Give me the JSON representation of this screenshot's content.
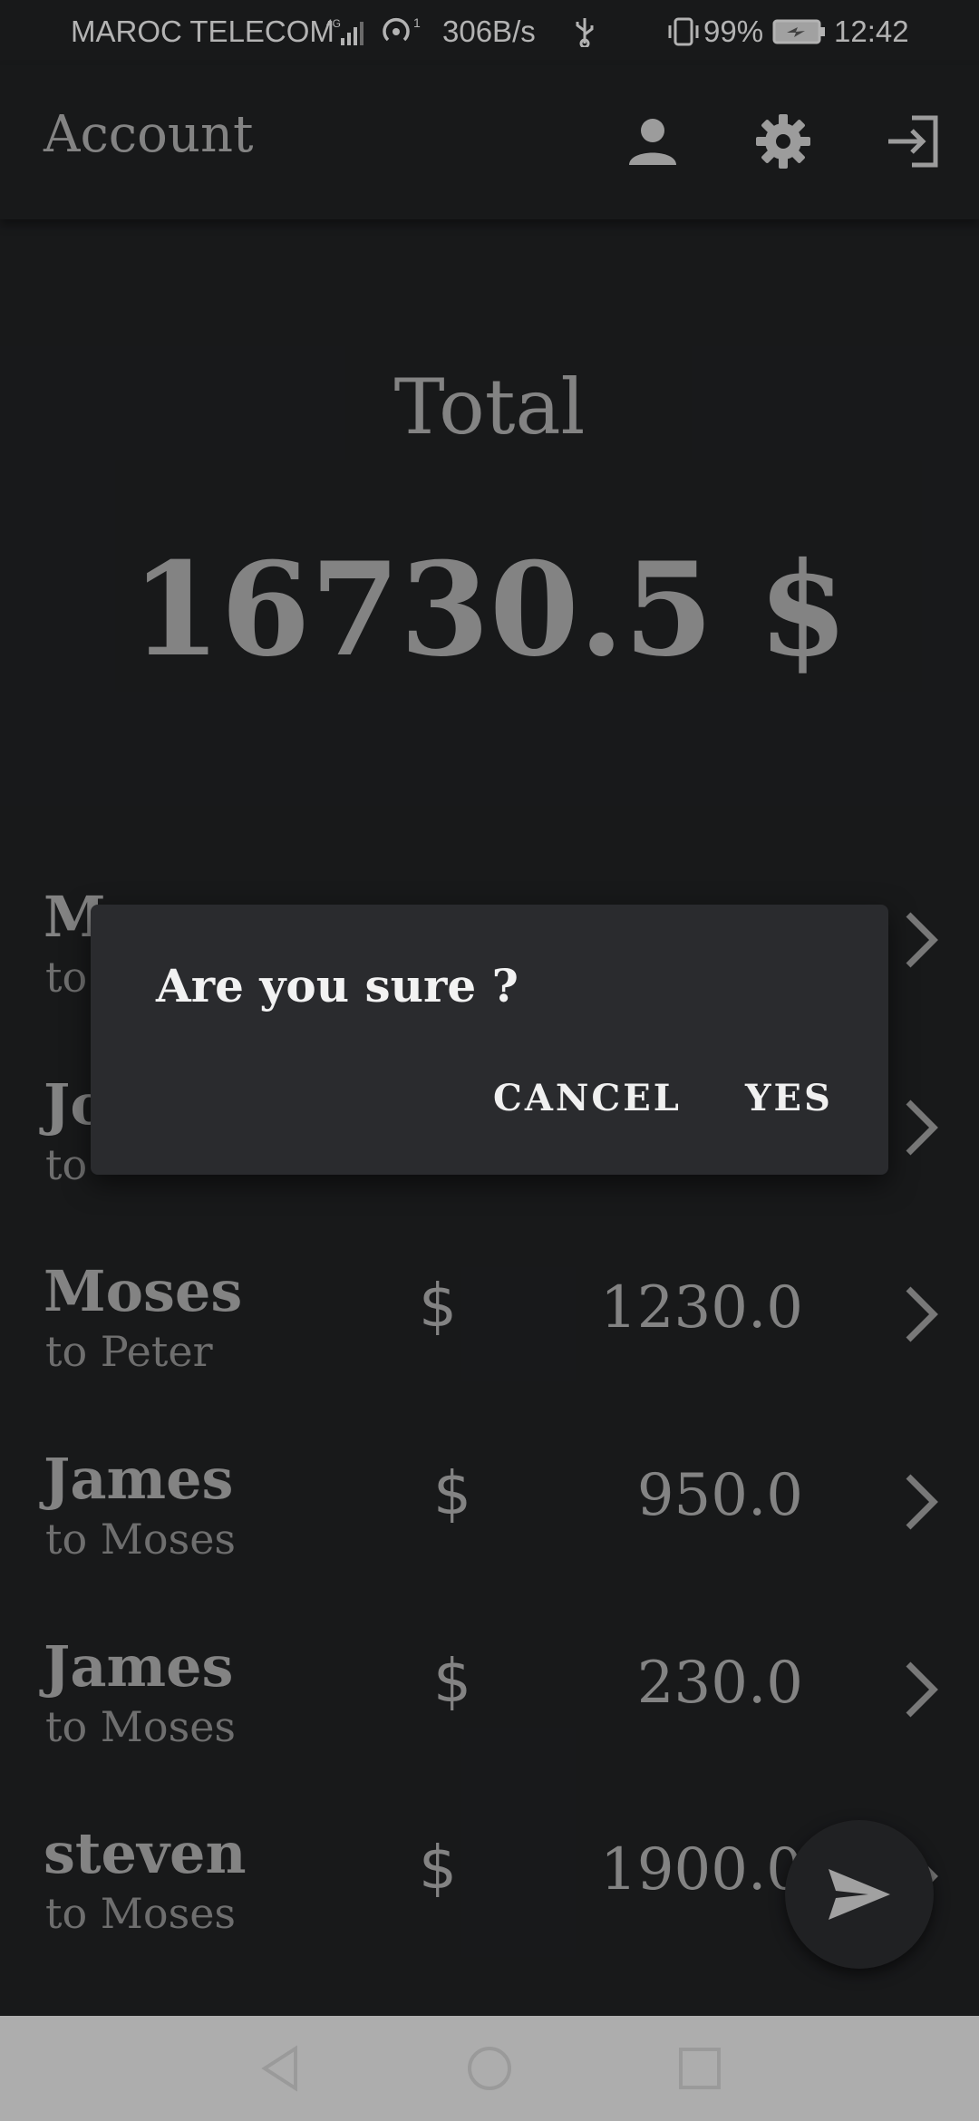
{
  "status_bar": {
    "carrier": "MAROC TELECOM",
    "network": "4G",
    "hotspot_count": "1",
    "speed": "306B/s",
    "battery": "99%",
    "time": "12:42"
  },
  "app_bar": {
    "title": "Account",
    "icons": [
      "person-icon",
      "gear-icon",
      "logout-icon"
    ]
  },
  "summary": {
    "label": "Total",
    "value": "16730.5 $"
  },
  "transactions": [
    {
      "from": "Moses",
      "to": "to Peter",
      "currency": "$",
      "amount": "1230.0"
    },
    {
      "from": "James",
      "to": "to Moses",
      "currency": "$",
      "amount": "950.0"
    },
    {
      "from": "James",
      "to": "to Moses",
      "currency": "$",
      "amount": "230.0"
    },
    {
      "from": "steven",
      "to": "to Moses",
      "currency": "$",
      "amount": "1900.0"
    }
  ],
  "partially_hidden_rows": [
    {
      "from_visible": "M",
      "to_visible": "to"
    },
    {
      "from_visible": "Jo",
      "to_visible": "to"
    }
  ],
  "dialog": {
    "message": "Are you sure ?",
    "cancel_label": "CANCEL",
    "confirm_label": "YES"
  },
  "fab": {
    "icon": "send-icon"
  },
  "nav_bar": {
    "icons": [
      "back-icon",
      "home-icon",
      "recents-icon"
    ]
  }
}
